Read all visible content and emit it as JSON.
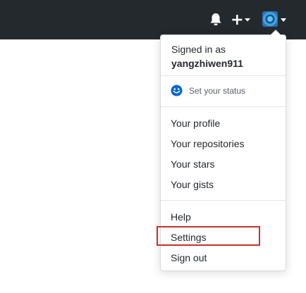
{
  "dropdown": {
    "signed_in_label": "Signed in as",
    "username": "yangzhiwen911",
    "status_label": "Set your status",
    "items_group1": [
      {
        "label": "Your profile"
      },
      {
        "label": "Your repositories"
      },
      {
        "label": "Your stars"
      },
      {
        "label": "Your gists"
      }
    ],
    "items_group2": [
      {
        "label": "Help"
      },
      {
        "label": "Settings"
      },
      {
        "label": "Sign out"
      }
    ]
  },
  "header": {
    "icons": [
      "bell-icon",
      "plus-icon",
      "avatar"
    ]
  },
  "colors": {
    "header_bg": "#24292e",
    "highlight": "#c9302c",
    "status_icon": "#0366d6"
  }
}
